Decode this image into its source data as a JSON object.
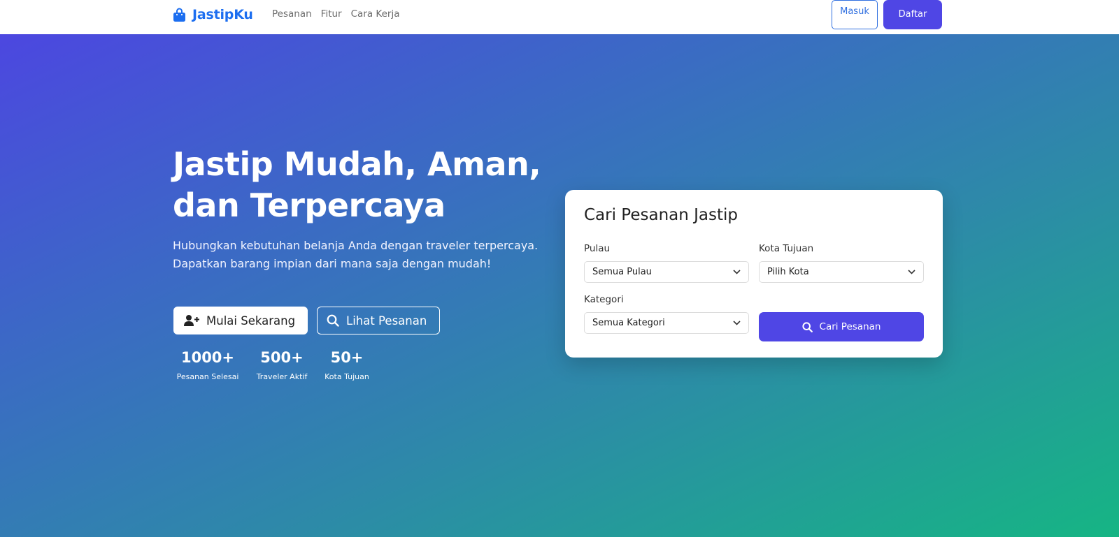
{
  "navbar": {
    "brand": "JastipKu",
    "links": [
      "Pesanan",
      "Fitur",
      "Cara Kerja"
    ],
    "login_label": "Masuk",
    "register_label": "Daftar",
    "brand_color": "#1c6ef0",
    "accent_color": "#4f46e5"
  },
  "hero": {
    "title_line1": "Jastip Mudah, Aman,",
    "title_line2": "dan Terpercaya",
    "subtitle": "Hubungkan kebutuhan belanja Anda dengan traveler terpercaya. Dapatkan barang impian dari mana saja dengan mudah!",
    "primary_cta": "Mulai Sekarang",
    "secondary_cta": "Lihat Pesanan",
    "stats": [
      {
        "value": "1000+",
        "label": "Pesanan Selesai"
      },
      {
        "value": "500+",
        "label": "Traveler Aktif"
      },
      {
        "value": "50+",
        "label": "Kota Tujuan"
      }
    ]
  },
  "search": {
    "title": "Cari Pesanan Jastip",
    "island_label": "Pulau",
    "island_value": "Semua Pulau",
    "city_label": "Kota Tujuan",
    "city_value": "Pilih Kota",
    "category_label": "Kategori",
    "category_value": "Semua Kategori",
    "button_label": "Cari Pesanan"
  },
  "icons": {
    "brand": "shopping-bag-icon",
    "primary_cta": "user-plus-icon",
    "secondary_cta": "search-icon",
    "select": "chevron-down-icon",
    "search_button": "search-icon"
  }
}
